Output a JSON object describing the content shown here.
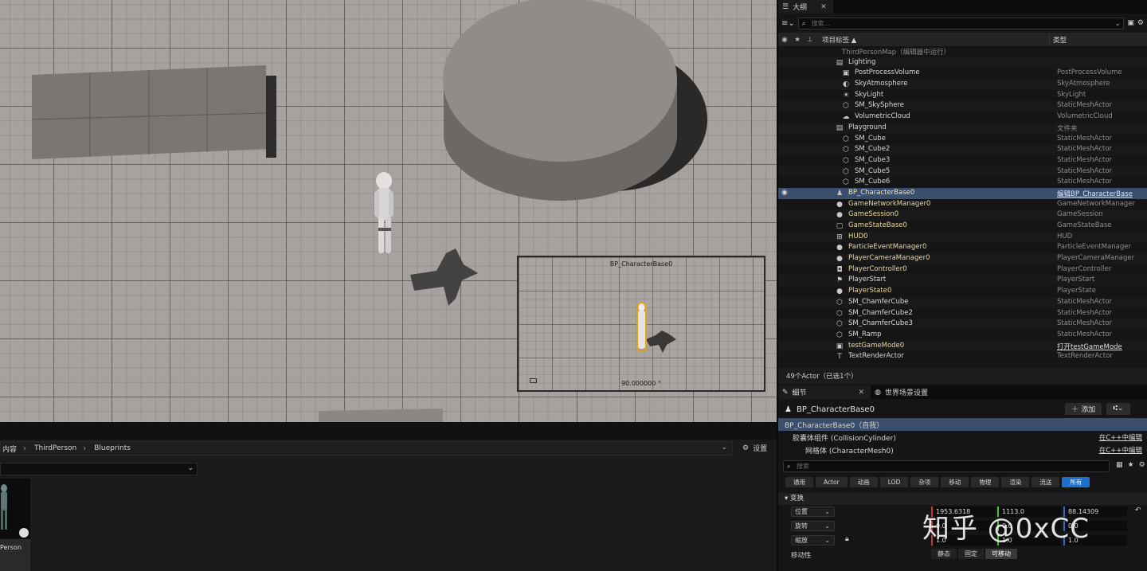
{
  "viewport": {
    "inset_title": "BP_CharacterBase0",
    "inset_value": "90.000000 °"
  },
  "content_browser": {
    "path": [
      "内容",
      "ThirdPerson",
      "Blueprints"
    ],
    "settings_label": "设置",
    "asset_label": "Person"
  },
  "outliner": {
    "tab_label": "大纲",
    "search_placeholder": "搜索...",
    "col_label": "项目标签 ▲",
    "col_type": "类型",
    "rows": [
      {
        "name": "ThirdPersonMap（编辑器中运行）",
        "type": "",
        "icon": "",
        "indent": 80,
        "cls": "dim"
      },
      {
        "name": "Lighting",
        "type": "",
        "icon": "folder-icon",
        "indent": 88,
        "cls": ""
      },
      {
        "name": "PostProcessVolume",
        "type": "PostProcessVolume",
        "icon": "volume-icon",
        "indent": 96,
        "cls": ""
      },
      {
        "name": "SkyAtmosphere",
        "type": "SkyAtmosphere",
        "icon": "atmosphere-icon",
        "indent": 96,
        "cls": ""
      },
      {
        "name": "SkyLight",
        "type": "SkyLight",
        "icon": "skylight-icon",
        "indent": 96,
        "cls": ""
      },
      {
        "name": "SM_SkySphere",
        "type": "StaticMeshActor",
        "icon": "static-mesh-icon",
        "indent": 96,
        "cls": ""
      },
      {
        "name": "VolumetricCloud",
        "type": "VolumetricCloud",
        "icon": "cloud-icon",
        "indent": 96,
        "cls": ""
      },
      {
        "name": "Playground",
        "type": "文件夹",
        "icon": "folder-icon",
        "indent": 88,
        "cls": ""
      },
      {
        "name": "SM_Cube",
        "type": "StaticMeshActor",
        "icon": "static-mesh-icon",
        "indent": 96,
        "cls": ""
      },
      {
        "name": "SM_Cube2",
        "type": "StaticMeshActor",
        "icon": "static-mesh-icon",
        "indent": 96,
        "cls": ""
      },
      {
        "name": "SM_Cube3",
        "type": "StaticMeshActor",
        "icon": "static-mesh-icon",
        "indent": 96,
        "cls": ""
      },
      {
        "name": "SM_Cube5",
        "type": "StaticMeshActor",
        "icon": "static-mesh-icon",
        "indent": 96,
        "cls": ""
      },
      {
        "name": "SM_Cube6",
        "type": "StaticMeshActor",
        "icon": "static-mesh-icon",
        "indent": 96,
        "cls": ""
      },
      {
        "name": "BP_CharacterBase0",
        "type": "编辑BP_CharacterBase",
        "icon": "pawn-icon",
        "indent": 88,
        "cls": "selected"
      },
      {
        "name": "GameNetworkManager0",
        "type": "GameNetworkManager",
        "icon": "actor-icon",
        "indent": 88,
        "cls": "yellow"
      },
      {
        "name": "GameSession0",
        "type": "GameSession",
        "icon": "actor-icon",
        "indent": 88,
        "cls": "yellow"
      },
      {
        "name": "GameStateBase0",
        "type": "GameStateBase",
        "icon": "gamestate-icon",
        "indent": 88,
        "cls": "yellow"
      },
      {
        "name": "HUD0",
        "type": "HUD",
        "icon": "hud-icon",
        "indent": 88,
        "cls": "yellow"
      },
      {
        "name": "ParticleEventManager0",
        "type": "ParticleEventManager",
        "icon": "actor-icon",
        "indent": 88,
        "cls": "yellow"
      },
      {
        "name": "PlayerCameraManager0",
        "type": "PlayerCameraManager",
        "icon": "actor-icon",
        "indent": 88,
        "cls": "yellow"
      },
      {
        "name": "PlayerController0",
        "type": "PlayerController",
        "icon": "gamepad-icon",
        "indent": 88,
        "cls": "yellow"
      },
      {
        "name": "PlayerStart",
        "type": "PlayerStart",
        "icon": "playerstart-icon",
        "indent": 88,
        "cls": ""
      },
      {
        "name": "PlayerState0",
        "type": "PlayerState",
        "icon": "actor-icon",
        "indent": 88,
        "cls": "yellow"
      },
      {
        "name": "SM_ChamferCube",
        "type": "StaticMeshActor",
        "icon": "static-mesh-icon",
        "indent": 88,
        "cls": ""
      },
      {
        "name": "SM_ChamferCube2",
        "type": "StaticMeshActor",
        "icon": "static-mesh-icon",
        "indent": 88,
        "cls": ""
      },
      {
        "name": "SM_ChamferCube3",
        "type": "StaticMeshActor",
        "icon": "static-mesh-icon",
        "indent": 88,
        "cls": ""
      },
      {
        "name": "SM_Ramp",
        "type": "StaticMeshActor",
        "icon": "static-mesh-icon",
        "indent": 88,
        "cls": ""
      },
      {
        "name": "testGameMode0",
        "type": "打开testGameMode",
        "icon": "gamemode-icon",
        "indent": 88,
        "cls": "yellow link"
      },
      {
        "name": "TextRenderActor",
        "type": "TextRenderActor",
        "icon": "text-render-icon",
        "indent": 88,
        "cls": ""
      }
    ],
    "status": "49个Actor（已选1个）"
  },
  "details": {
    "tab_label": "细节",
    "tab2_label": "世界场景设置",
    "actor_name": "BP_CharacterBase0",
    "add_label": "添加",
    "components": [
      {
        "label": "BP_CharacterBase0（自我）",
        "edit": "",
        "indent": 8,
        "sel": true
      },
      {
        "label": "胶囊体组件 (CollisionCylinder)",
        "edit": "在C++中编辑",
        "indent": 18,
        "sel": false
      },
      {
        "label": "网格体 (CharacterMesh0)",
        "edit": "在C++中编辑",
        "indent": 34,
        "sel": false
      }
    ],
    "search_placeholder": "搜索",
    "filters": [
      "通用",
      "Actor",
      "动画",
      "LOD",
      "杂项",
      "移动",
      "物理",
      "渲染",
      "流送",
      "所有"
    ],
    "section": "变换",
    "props": [
      {
        "name": "位置",
        "x": "1953.6318",
        "y": "1113.0",
        "z": "88.14309"
      },
      {
        "name": "旋转",
        "x": "0.0",
        "y": "0.0",
        "z": "0.0"
      },
      {
        "name": "缩放",
        "x": "1.0",
        "y": "1.0",
        "z": "1.0"
      }
    ],
    "mobility_label": "移动性",
    "mobility": [
      "静态",
      "固定",
      "可移动"
    ]
  },
  "watermark": "知乎 @0xCC"
}
